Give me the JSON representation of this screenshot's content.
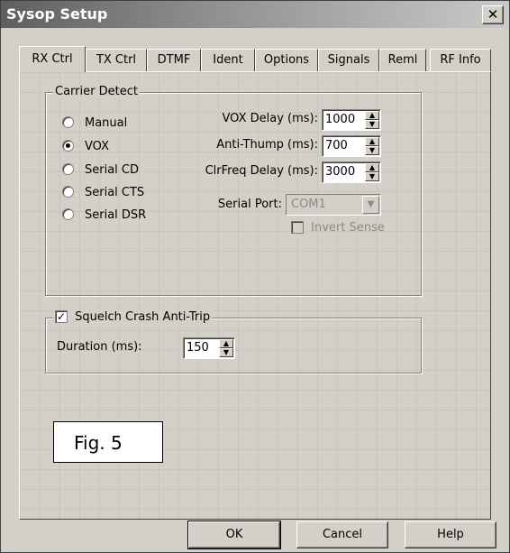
{
  "window": {
    "title": "Sysop Setup",
    "close_label": "✕"
  },
  "tabs": [
    {
      "label": "RX Ctrl",
      "active": true
    },
    {
      "label": "TX Ctrl"
    },
    {
      "label": "DTMF"
    },
    {
      "label": "Ident"
    },
    {
      "label": "Options"
    },
    {
      "label": "Signals"
    },
    {
      "label": "Reml"
    },
    {
      "label": "RF Info"
    }
  ],
  "carrier_detect": {
    "legend": "Carrier Detect",
    "options": [
      {
        "label": "Manual",
        "checked": false
      },
      {
        "label": "VOX",
        "checked": true
      },
      {
        "label": "Serial CD",
        "checked": false
      },
      {
        "label": "Serial CTS",
        "checked": false
      },
      {
        "label": "Serial DSR",
        "checked": false
      }
    ],
    "vox_delay": {
      "label": "VOX Delay (ms):",
      "value": "1000"
    },
    "anti_thump": {
      "label": "Anti-Thump (ms):",
      "value": "700"
    },
    "clrfreq_delay": {
      "label": "ClrFreq Delay (ms):",
      "value": "3000"
    },
    "serial_port": {
      "label": "Serial Port:",
      "value": "COM1"
    },
    "invert_sense": {
      "label": "Invert Sense",
      "checked": false,
      "disabled": true
    }
  },
  "squelch": {
    "legend": "Squelch Crash Anti-Trip",
    "checked": true,
    "duration": {
      "label": "Duration (ms):",
      "value": "150"
    }
  },
  "figure_label": "Fig. 5",
  "buttons": {
    "ok": "OK",
    "cancel": "Cancel",
    "help": "Help"
  }
}
